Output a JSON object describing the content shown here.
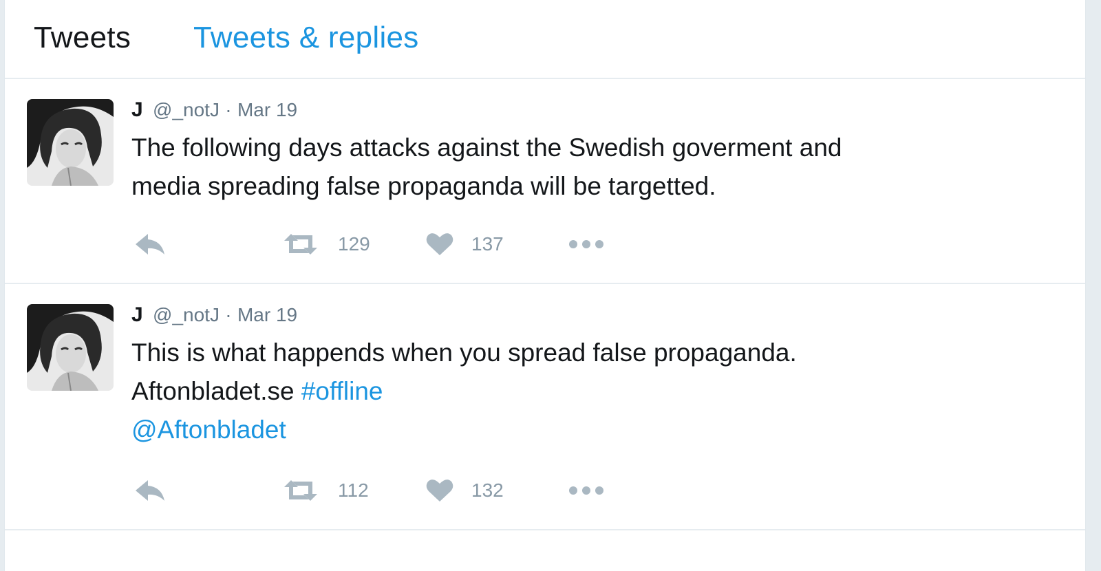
{
  "tabs": {
    "tweets_label": "Tweets",
    "replies_label": "Tweets & replies"
  },
  "tweets": [
    {
      "name": "J",
      "handle": "@_notJ",
      "separator": "·",
      "date": "Mar 19",
      "lines": [
        "The following days attacks against the Swedish goverment and",
        "media spreading false propaganda will be targetted."
      ],
      "retweets": "129",
      "likes": "137"
    },
    {
      "name": "J",
      "handle": "@_notJ",
      "separator": "·",
      "date": "Mar 19",
      "line1": "This is what happends when you spread false propaganda.",
      "line2_text": "Aftonbladet.se",
      "line2_hashtag": "#offline",
      "mention": "@Aftonbladet",
      "retweets": "112",
      "likes": "132"
    }
  ],
  "icons": {
    "reply": "reply-icon",
    "retweet": "retweet-icon",
    "like": "heart-icon",
    "more": "more-icon"
  },
  "colors": {
    "link": "#1b95e0",
    "text": "#14171a",
    "muted": "#657786",
    "icon": "#aab8c2",
    "divider": "#e6ecf0"
  }
}
